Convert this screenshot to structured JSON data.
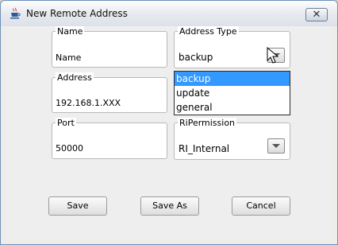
{
  "window": {
    "title": "New Remote Address",
    "close_label": "✕"
  },
  "fields": {
    "name": {
      "label": "Name",
      "value": "Name"
    },
    "address": {
      "label": "Address",
      "value": "192.168.1.XXX"
    },
    "port": {
      "label": "Port",
      "value": "50000"
    },
    "address_type": {
      "label": "Address Type",
      "value": "backup",
      "options": [
        "backup",
        "update",
        "general"
      ],
      "selected_option": "backup"
    },
    "ri_permission": {
      "label": "RiPermission",
      "value": "RI_Internal"
    }
  },
  "buttons": {
    "save": "Save",
    "save_as": "Save As",
    "cancel": "Cancel"
  },
  "colors": {
    "selection": "#3399ff",
    "title_border": "#6f8fb9"
  },
  "icons": {
    "title": "java-cup-icon",
    "close": "close-icon",
    "arrow": "chevron-down-icon",
    "cursor": "mouse-pointer-icon"
  }
}
